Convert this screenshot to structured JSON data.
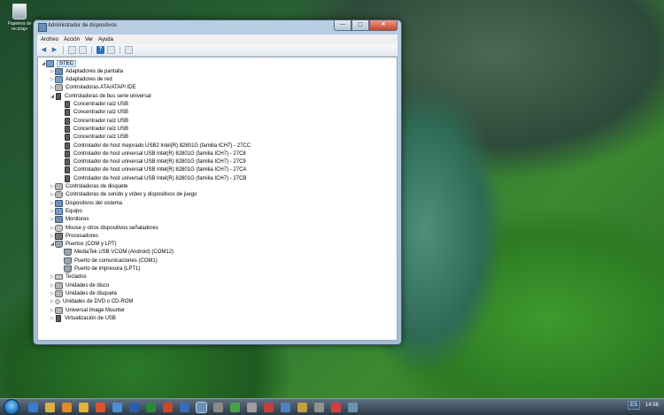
{
  "desktop": {
    "icon_label": "Papelera de reciclaje"
  },
  "window": {
    "title": "Administrador de dispositivos",
    "controls": {
      "minimize": "—",
      "maximize": "▢",
      "close": "✕"
    }
  },
  "menu": [
    "Archivo",
    "Acción",
    "Ver",
    "Ayuda"
  ],
  "toolbar": {
    "back": "◀",
    "forward": "▶",
    "help": "?"
  },
  "tree": [
    {
      "label": "STEC",
      "level": 0,
      "expanded": true,
      "icon": "computer-icon",
      "root": true
    },
    {
      "label": "Adaptadores de pantalla",
      "level": 1,
      "expanded": false,
      "icon": "monitor-icon"
    },
    {
      "label": "Adaptadores de red",
      "level": 1,
      "expanded": false,
      "icon": "network-adapter-icon"
    },
    {
      "label": "Controladoras ATA/ATAPI IDE",
      "level": 1,
      "expanded": false,
      "icon": "drive-icon"
    },
    {
      "label": "Controladoras de bus serie universal",
      "level": 1,
      "expanded": true,
      "icon": "usb-icon"
    },
    {
      "label": "Concentrador raíz USB",
      "level": 2,
      "icon": "usb-icon"
    },
    {
      "label": "Concentrador raíz USB",
      "level": 2,
      "icon": "usb-icon"
    },
    {
      "label": "Concentrador raíz USB",
      "level": 2,
      "icon": "usb-icon"
    },
    {
      "label": "Concentrador raíz USB",
      "level": 2,
      "icon": "usb-icon"
    },
    {
      "label": "Concentrador raíz USB",
      "level": 2,
      "icon": "usb-icon"
    },
    {
      "label": "Controlador de host mejorado USB2 Intel(R) 82801G (familia ICH7) - 27CC",
      "level": 2,
      "icon": "usb-icon"
    },
    {
      "label": "Controlador de host universal USB Intel(R) 82801G (familia ICH7) - 27C8",
      "level": 2,
      "icon": "usb-icon"
    },
    {
      "label": "Controlador de host universal USB Intel(R) 82801G (familia ICH7) - 27C9",
      "level": 2,
      "icon": "usb-icon"
    },
    {
      "label": "Controlador de host universal USB Intel(R) 82801G (familia ICH7) - 27CA",
      "level": 2,
      "icon": "usb-icon"
    },
    {
      "label": "Controlador de host universal USB Intel(R) 82801G (familia ICH7) - 27CB",
      "level": 2,
      "icon": "usb-icon"
    },
    {
      "label": "Controladoras de disquete",
      "level": 1,
      "expanded": false,
      "icon": "drive-icon"
    },
    {
      "label": "Controladoras de sonido y vídeo y dispositivos de juego",
      "level": 1,
      "expanded": false,
      "icon": "sound-icon"
    },
    {
      "label": "Dispositivos del sistema",
      "level": 1,
      "expanded": false,
      "icon": "system-device-icon"
    },
    {
      "label": "Equipo",
      "level": 1,
      "expanded": false,
      "icon": "computer-icon"
    },
    {
      "label": "Monitores",
      "level": 1,
      "expanded": false,
      "icon": "monitor-icon"
    },
    {
      "label": "Mouse y otros dispositivos señaladores",
      "level": 1,
      "expanded": false,
      "icon": "mouse-icon"
    },
    {
      "label": "Procesadores",
      "level": 1,
      "expanded": false,
      "icon": "processor-icon"
    },
    {
      "label": "Puertos (COM y LPT)",
      "level": 1,
      "expanded": true,
      "icon": "port-icon"
    },
    {
      "label": "MediaTek USB VCOM (Android) (COM12)",
      "level": 2,
      "icon": "port-icon"
    },
    {
      "label": "Puerto de comunicaciones (COM1)",
      "level": 2,
      "icon": "port-icon"
    },
    {
      "label": "Puerto de impresora (LPT1)",
      "level": 2,
      "icon": "port-icon"
    },
    {
      "label": "Teclados",
      "level": 1,
      "expanded": false,
      "icon": "keyboard-icon"
    },
    {
      "label": "Unidades de disco",
      "level": 1,
      "expanded": false,
      "icon": "drive-icon"
    },
    {
      "label": "Unidades de disquete",
      "level": 1,
      "expanded": false,
      "icon": "drive-icon"
    },
    {
      "label": "Unidades de DVD o CD-ROM",
      "level": 1,
      "expanded": false,
      "icon": "dvd-icon"
    },
    {
      "label": "Universal Image Mounter",
      "level": 1,
      "expanded": false,
      "icon": "drive-icon"
    },
    {
      "label": "Virtualización de USB",
      "level": 1,
      "expanded": false,
      "icon": "usb-icon"
    }
  ],
  "taskbar": {
    "language": "ES",
    "clock": "14:56",
    "tasks": [
      {
        "icon": "ie-icon",
        "color": "#3b7bd0"
      },
      {
        "icon": "explorer-icon",
        "color": "#d8b14a"
      },
      {
        "icon": "media-player-icon",
        "color": "#e08a2a"
      },
      {
        "icon": "chrome-icon",
        "color": "#e4b33a"
      },
      {
        "icon": "firefox-icon",
        "color": "#d8542a"
      },
      {
        "icon": "app-icon",
        "color": "#4a90d0"
      },
      {
        "icon": "word-icon",
        "color": "#2b5ea8"
      },
      {
        "icon": "excel-icon",
        "color": "#2a8a3a"
      },
      {
        "icon": "powerpoint-icon",
        "color": "#c84a2a"
      },
      {
        "icon": "outlook-icon",
        "color": "#3a6ab8"
      },
      {
        "icon": "device-manager-icon",
        "color": "#6b8fb5",
        "active": true
      },
      {
        "icon": "app-icon",
        "color": "#8a8a8a"
      },
      {
        "icon": "app-icon",
        "color": "#4aa04a"
      },
      {
        "icon": "app-icon",
        "color": "#a0a0a0"
      },
      {
        "icon": "app-icon",
        "color": "#c04040"
      },
      {
        "icon": "app-icon",
        "color": "#5080c0"
      },
      {
        "icon": "app-icon",
        "color": "#c0a040"
      },
      {
        "icon": "app-icon",
        "color": "#909090"
      },
      {
        "icon": "app-icon",
        "color": "#d04040"
      },
      {
        "icon": "app-icon",
        "color": "#7090b0"
      }
    ]
  }
}
